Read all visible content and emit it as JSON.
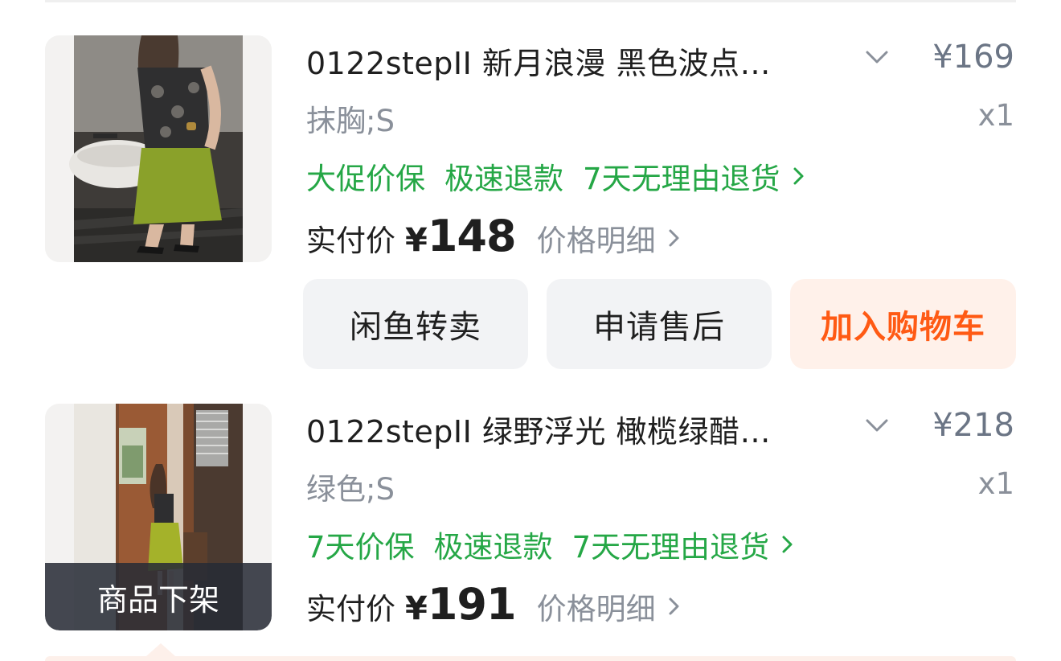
{
  "order_items": [
    {
      "title": "0122stepII 新月浪漫 黑色波点…",
      "price": "¥169",
      "sku": "抹胸;S",
      "quantity": "x1",
      "tags": [
        "大促价保",
        "极速退款",
        "7天无理由退货"
      ],
      "paid_label": "实付价",
      "paid_currency": "¥",
      "paid_amount": "148",
      "price_detail": "价格明细",
      "delisted": false
    },
    {
      "title": "0122stepII 绿野浮光 橄榄绿醋…",
      "price": "¥218",
      "sku": "绿色;S",
      "quantity": "x1",
      "tags": [
        "7天价保",
        "极速退款",
        "7天无理由退货"
      ],
      "paid_label": "实付价",
      "paid_currency": "¥",
      "paid_amount": "191",
      "price_detail": "价格明细",
      "delisted": true,
      "delisted_label": "商品下架"
    }
  ],
  "actions": {
    "resell": "闲鱼转卖",
    "after_sales": "申请售后",
    "add_to_cart": "加入购物车"
  },
  "icons": {
    "expand": "chevron-down-icon",
    "tags_more": "chevron-right-icon",
    "price_detail": "chevron-right-icon"
  },
  "colors": {
    "guarantee_green": "#25a746",
    "cart_orange": "#ff5a14",
    "cart_bg": "#fff1ea",
    "muted_gray": "#8a909a",
    "button_bg": "#f2f3f5"
  }
}
